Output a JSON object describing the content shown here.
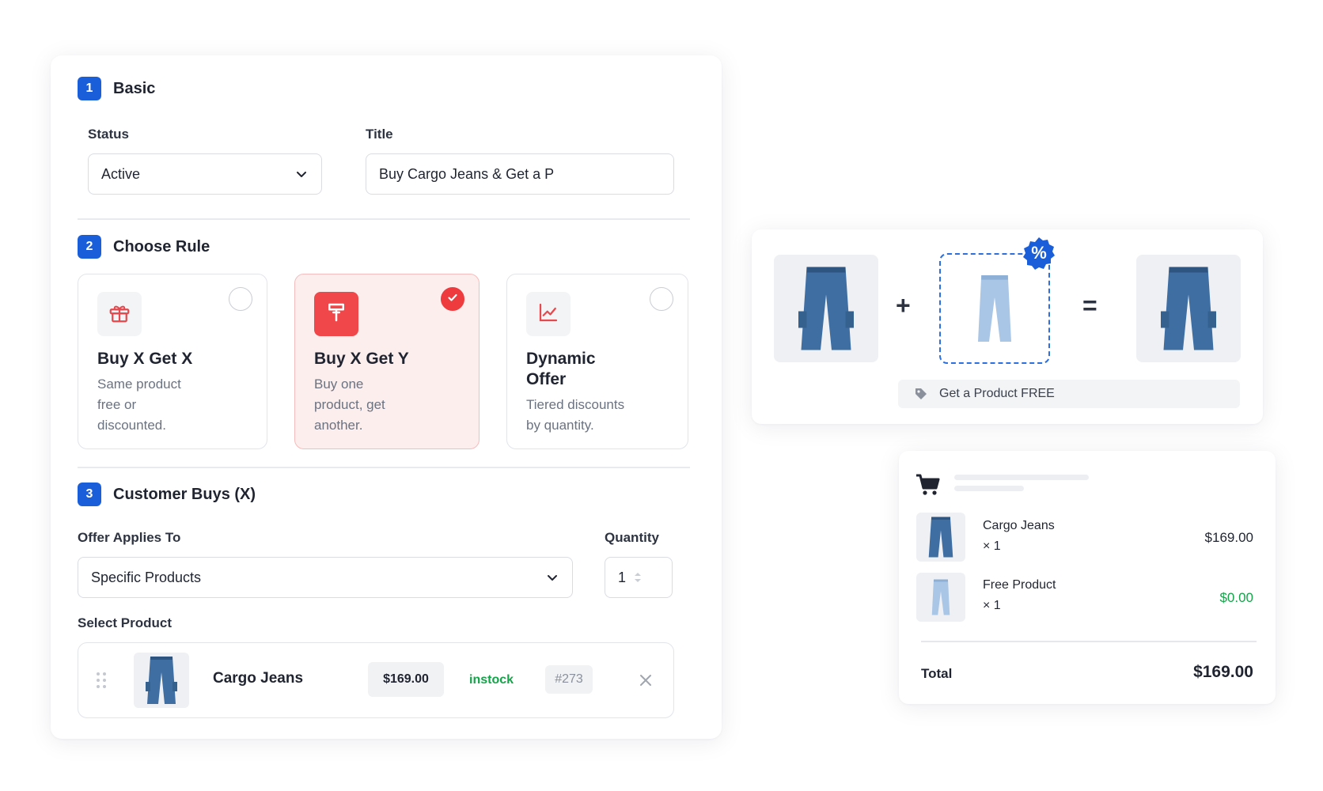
{
  "basic": {
    "step": "1",
    "title": "Basic",
    "status_label": "Status",
    "status_value": "Active",
    "title_label": "Title",
    "title_value": "Buy Cargo Jeans & Get a P"
  },
  "rule": {
    "step": "2",
    "title": "Choose Rule",
    "options": [
      {
        "title": "Buy X Get X",
        "desc": [
          "Same product",
          "free or",
          "discounted."
        ],
        "icon": "gift-icon",
        "selected": false
      },
      {
        "title": "Buy X Get Y",
        "desc": [
          "Buy one",
          "product, get",
          "another."
        ],
        "icon": "tag-icon",
        "selected": true
      },
      {
        "title_lines": [
          "Dynamic",
          "Offer"
        ],
        "desc": [
          "Tiered discounts",
          "by quantity."
        ],
        "icon": "chart-icon",
        "selected": false
      }
    ]
  },
  "customer": {
    "step": "3",
    "title": "Customer Buys (X)",
    "applies_label": "Offer Applies To",
    "applies_value": "Specific Products",
    "quantity_label": "Quantity",
    "quantity_value": "1",
    "select_label": "Select Product",
    "product": {
      "name": "Cargo Jeans",
      "price": "$169.00",
      "stock": "instock",
      "id": "#273"
    }
  },
  "offer_preview": {
    "badge": "%",
    "plus": "+",
    "equals": "=",
    "free_text": "Get a Product FREE"
  },
  "cart": {
    "items": [
      {
        "name": "Cargo Jeans",
        "qty": "× 1",
        "price": "$169.00"
      },
      {
        "name": "Free Product",
        "qty": "× 1",
        "price": "$0.00"
      }
    ],
    "total_label": "Total",
    "total_value": "$169.00"
  },
  "colors": {
    "accent_blue": "#1a5fd9",
    "accent_red": "#ee3b3e",
    "instock_green": "#16a34a",
    "jeans_dark": "#3f6ea3",
    "jeans_light": "#a9c6e6"
  }
}
